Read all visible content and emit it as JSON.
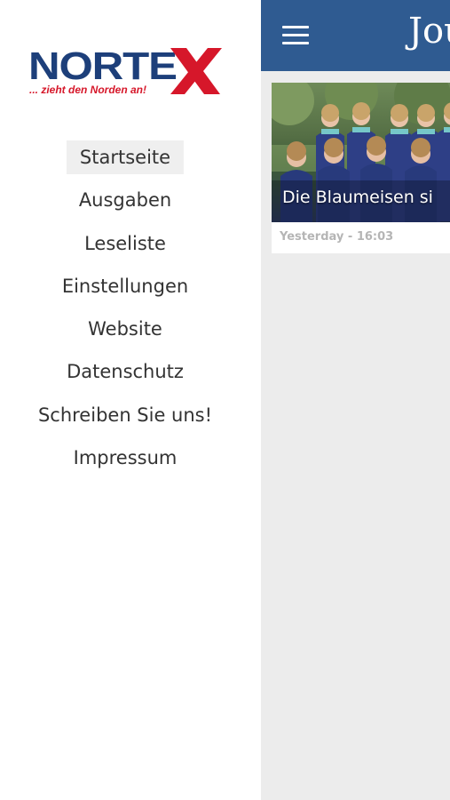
{
  "drawer": {
    "logo": {
      "word": "NORTE",
      "x_letter": "X",
      "tagline": "... zieht den Norden an!"
    },
    "menu": [
      {
        "label": "Startseite",
        "active": true
      },
      {
        "label": "Ausgaben"
      },
      {
        "label": "Leseliste"
      },
      {
        "label": "Einstellungen"
      },
      {
        "label": "Website"
      },
      {
        "label": "Datenschutz"
      },
      {
        "label": "Schreiben Sie uns!"
      },
      {
        "label": "Impressum"
      }
    ]
  },
  "main": {
    "header": {
      "brand_visible": "Jou",
      "menu_icon": "hamburger-icon"
    },
    "article": {
      "caption": "Die Blaumeisen si",
      "timestamp": "Yesterday - 16:03"
    }
  },
  "colors": {
    "header_bg": "#2f5b91",
    "logo_blue": "#1d3f7a",
    "logo_red": "#d6172a",
    "content_bg": "#ececec",
    "active_item_bg": "#efefef"
  }
}
